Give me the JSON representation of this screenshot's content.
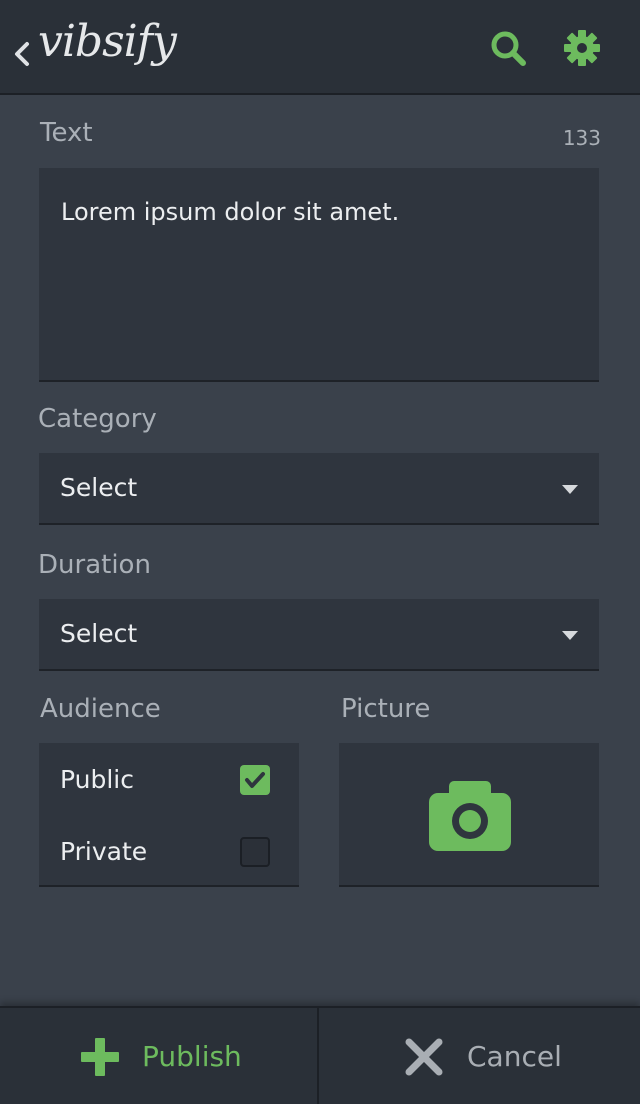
{
  "app": {
    "name": "vibsify"
  },
  "header": {
    "back_icon": "chevron-left-icon",
    "search_icon": "search-icon",
    "settings_icon": "gear-icon"
  },
  "form": {
    "text": {
      "label": "Text",
      "counter": "133",
      "value": "Lorem ipsum dolor sit amet."
    },
    "category": {
      "label": "Category",
      "value": "Select"
    },
    "duration": {
      "label": "Duration",
      "value": "Select"
    },
    "audience": {
      "label": "Audience",
      "options": [
        {
          "label": "Public",
          "checked": true
        },
        {
          "label": "Private",
          "checked": false
        }
      ]
    },
    "picture": {
      "label": "Picture",
      "icon": "camera-icon"
    }
  },
  "actions": {
    "publish_label": "Publish",
    "cancel_label": "Cancel"
  },
  "colors": {
    "accent": "#6dbb5e",
    "background": "#3a414b",
    "bar": "#2a3038",
    "field": "#2f353e"
  }
}
